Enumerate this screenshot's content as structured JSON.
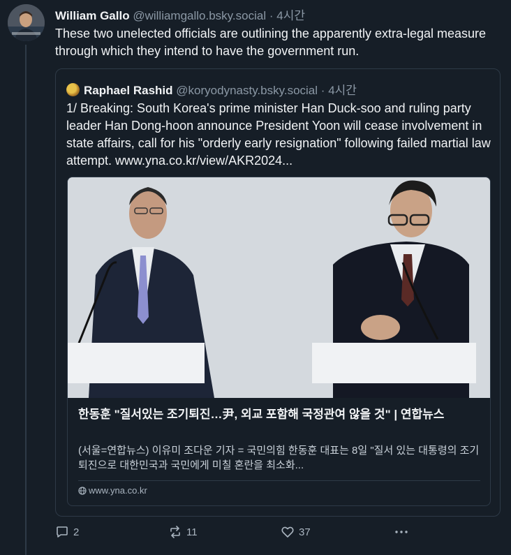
{
  "post": {
    "author_name": "William Gallo",
    "author_handle": "@williamgallo.bsky.social",
    "separator": "·",
    "time": "4시간",
    "text": "These two unelected officials are outlining the apparently extra-legal measure through which they intend to have the government run."
  },
  "quote": {
    "author_name": "Raphael Rashid",
    "author_handle": "@koryodynasty.bsky.social",
    "separator": "·",
    "time": "4시간",
    "text": "1/ Breaking: South Korea's prime minister Han Duck-soo and ruling party leader Han Dong-hoon announce President Yoon will cease involvement in state affairs, call for his \"orderly early resignation\" following failed martial law attempt. www.yna.co.kr/view/AKR2024...",
    "card": {
      "title": "한동훈 \"질서있는 조기퇴진…尹, 외교 포함해 국정관여 않을 것\" | 연합뉴스",
      "description": "(서울=연합뉴스) 이유미 조다운 기자 = 국민의힘 한동훈 대표는 8일 \"질서 있는 대통령의 조기 퇴진으로 대한민국과 국민에게 미칠 혼란을 최소화...",
      "domain": "www.yna.co.kr"
    }
  },
  "actions": {
    "replies": "2",
    "reposts": "11",
    "likes": "37"
  },
  "colors": {
    "background": "#161e27",
    "text": "#f1f3f5",
    "muted": "#8b98a5",
    "border": "#2e3a47"
  },
  "icons": [
    "reply-icon",
    "repost-icon",
    "like-icon",
    "more-icon",
    "globe-icon"
  ]
}
